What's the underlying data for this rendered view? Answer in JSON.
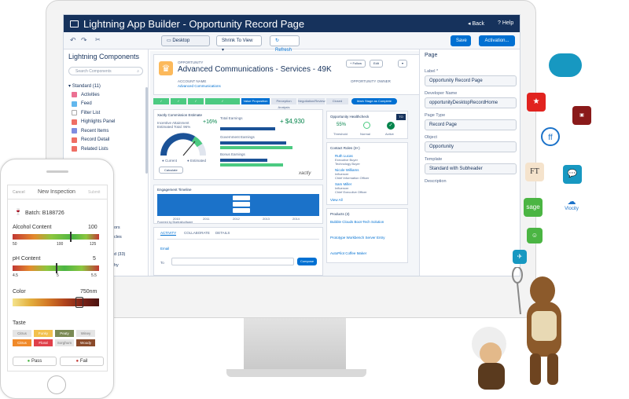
{
  "app": {
    "title": "Lightning App Builder - Opportunity Record Page",
    "back": "Back",
    "help": "Help"
  },
  "toolbar": {
    "device": "Desktop",
    "zoom": "Shrink To View",
    "refresh": "Refresh",
    "save": "Save",
    "activation": "Activation..."
  },
  "left": {
    "title": "Lightning Components",
    "search_placeholder": "Search Components",
    "section": "Standard (11)",
    "items": [
      "Activities",
      "Feed",
      "Filter List",
      "Highlights Panel",
      "Recent Items",
      "Record Detail",
      "Related Lists"
    ],
    "partial": [
      "ors",
      "cles",
      "d (33)",
      "hy"
    ]
  },
  "record": {
    "object": "OPPORTUNITY",
    "title": "Advanced Communications - Services - 49K",
    "follow": "+ Follow",
    "edit": "Edit",
    "account_label": "ACCOUNT NAME",
    "account": "Advanced Communications",
    "owner_label": "OPPORTUNITY OWNER",
    "path": [
      "",
      "",
      "",
      "",
      "Value Proposition",
      "Perception Analysis",
      "Negotiation/Review",
      "Closed",
      "Mark Stage as Complete"
    ]
  },
  "estimate": {
    "title": "Xactly Commission Estimate",
    "base_label": "Incentive Attainment",
    "base_label2": "Estimated Total: 96%",
    "base_pct": "+16%",
    "total_label": "Total Earnings",
    "total_value": "+ $4,930",
    "gov_label": "Government Earnings",
    "bonus_label": "Bonus Earnings",
    "brand": "xactly",
    "calc": "Calculate",
    "legend1": "Current",
    "legend2": "Estimated"
  },
  "health": {
    "title": "Opportunity Healthcheck",
    "badge": "TO",
    "pct": "55%",
    "l1": "Threshold",
    "l2": "Normal",
    "l3": "Active"
  },
  "timeline": {
    "title": "Engagement Timeline",
    "years": [
      "2010",
      "2011",
      "2012",
      "2013",
      "2014"
    ],
    "footer": "Powered by Bluetrailsoftware"
  },
  "tabs": [
    "ACTIVITY",
    "COLLABORATE",
    "DETAILS"
  ],
  "compose": {
    "label": "Email",
    "to": "To",
    "button": "Compose"
  },
  "contacts": {
    "title": "Contact Roles (3+)",
    "view_all": "View All",
    "items": [
      {
        "name": "Ruth Lucas",
        "role": "Executive Buyer",
        "title": "Technology Buyer"
      },
      {
        "name": "Nicole Williams",
        "role": "Influencer",
        "title": "Chief Information Officer"
      },
      {
        "name": "Sam Miller",
        "role": "Influencer",
        "title": "Chief Executive Officer"
      }
    ]
  },
  "products": {
    "title": "Products (3)",
    "items": [
      "Bubble Clouds Boot-Tech Solution",
      "Prototype Workbench Server Entry",
      "AutoPilot Coffee Maker"
    ]
  },
  "props": {
    "header": "Page",
    "label_l": "Label *",
    "label_v": "Opportunity Record Page",
    "dev_l": "Developer Name",
    "dev_v": "opportunityDesktopRecordHome",
    "type_l": "Page Type",
    "type_v": "Record Page",
    "obj_l": "Object",
    "obj_v": "Opportunity",
    "tmpl_l": "Template",
    "tmpl_v": "Standard with Subheader",
    "desc_l": "Description"
  },
  "phone": {
    "cancel": "Cancel",
    "title": "New Inspection",
    "submit": "Submit",
    "batch": "Batch: B188726",
    "alcohol": {
      "label": "Alcohol Content",
      "value": "100",
      "ticks": [
        "50",
        "100",
        "125"
      ],
      "level": 0.66
    },
    "ph": {
      "label": "pH Content",
      "value": "5",
      "ticks": [
        "4.5",
        "5",
        "5.5"
      ],
      "level": 0.5
    },
    "color": {
      "label": "Color",
      "value": "750nm"
    },
    "taste": {
      "label": "Taste",
      "tags": [
        "Citrus",
        "Funky",
        "Peaty",
        "Winey",
        "Citrus",
        "Floral",
        "Sorghum",
        "Woody"
      ]
    },
    "pass": "Pass",
    "fail": "Fail"
  },
  "apps": {
    "sage": "sage",
    "vlocity": "Vlocity",
    "ft": "FT"
  }
}
